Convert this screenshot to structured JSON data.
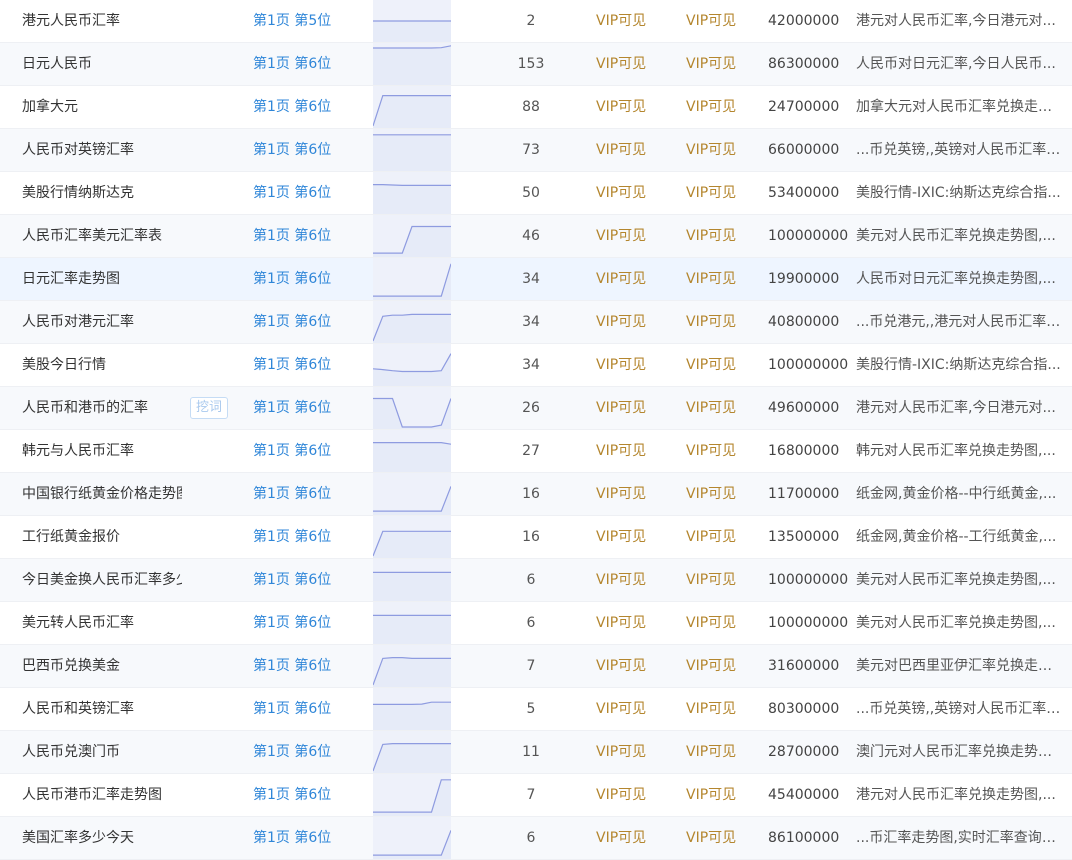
{
  "colors": {
    "link": "#2f86d8",
    "vip": "#b4862e",
    "trend_line": "#8e9be0",
    "trend_bg": "#eef1fa"
  },
  "rows": [
    {
      "keyword": "港元人民币汇率",
      "rank": "第1页 第5位",
      "count": "2",
      "vip1": "VIP可见",
      "vip2": "VIP可见",
      "volume": "42000000",
      "desc": "港元对人民币汇率,今日港元对...",
      "trend": [
        0.5,
        0.5,
        0.5,
        0.5,
        0.5,
        0.5,
        0.5,
        0.5,
        0.5
      ]
    },
    {
      "keyword": "日元人民币",
      "rank": "第1页 第6位",
      "count": "153",
      "vip1": "VIP可见",
      "vip2": "VIP可见",
      "volume": "86300000",
      "desc": "人民币对日元汇率,今日人民币...",
      "trend": [
        0.92,
        0.92,
        0.92,
        0.92,
        0.92,
        0.92,
        0.92,
        0.93,
        0.98
      ]
    },
    {
      "keyword": "加拿大元",
      "rank": "第1页 第6位",
      "count": "88",
      "vip1": "VIP可见",
      "vip2": "VIP可见",
      "volume": "24700000",
      "desc": "加拿大元对人民币汇率兑换走势...",
      "trend": [
        0.0,
        0.8,
        0.8,
        0.8,
        0.8,
        0.8,
        0.8,
        0.8,
        0.8
      ]
    },
    {
      "keyword": "人民币对英镑汇率",
      "rank": "第1页 第6位",
      "count": "73",
      "vip1": "VIP可见",
      "vip2": "VIP可见",
      "volume": "66000000",
      "desc": "...币兑英镑,,英镑对人民币汇率,...",
      "trend": [
        0.9,
        0.9,
        0.9,
        0.9,
        0.9,
        0.9,
        0.9,
        0.9,
        0.9
      ]
    },
    {
      "keyword": "美股行情纳斯达克",
      "rank": "第1页 第6位",
      "count": "50",
      "vip1": "VIP可见",
      "vip2": "VIP可见",
      "volume": "53400000",
      "desc": "美股行情-IXIC:纳斯达克综合指...",
      "trend": [
        0.72,
        0.72,
        0.71,
        0.7,
        0.7,
        0.7,
        0.7,
        0.7,
        0.7
      ]
    },
    {
      "keyword": "人民币汇率美元汇率表",
      "rank": "第1页 第6位",
      "count": "46",
      "vip1": "VIP可见",
      "vip2": "VIP可见",
      "volume": "100000000",
      "desc": "美元对人民币汇率兑换走势图,...",
      "trend": [
        0.05,
        0.05,
        0.05,
        0.05,
        0.75,
        0.75,
        0.75,
        0.75,
        0.75
      ]
    },
    {
      "keyword": "日元汇率走势图",
      "rank": "第1页 第6位",
      "count": "34",
      "vip1": "VIP可见",
      "vip2": "VIP可见",
      "volume": "19900000",
      "desc": "人民币对日元汇率兑换走势图,...",
      "trend": [
        0.05,
        0.05,
        0.05,
        0.05,
        0.05,
        0.05,
        0.05,
        0.05,
        0.9
      ]
    },
    {
      "keyword": "人民币对港元汇率",
      "rank": "第1页 第6位",
      "count": "34",
      "vip1": "VIP可见",
      "vip2": "VIP可见",
      "volume": "40800000",
      "desc": "...币兑港元,,港元对人民币汇率,...",
      "trend": [
        0.0,
        0.65,
        0.68,
        0.68,
        0.7,
        0.7,
        0.7,
        0.7,
        0.7
      ]
    },
    {
      "keyword": "美股今日行情",
      "rank": "第1页 第6位",
      "count": "34",
      "vip1": "VIP可见",
      "vip2": "VIP可见",
      "volume": "100000000",
      "desc": "美股行情-IXIC:纳斯达克综合指...",
      "trend": [
        0.4,
        0.38,
        0.35,
        0.33,
        0.33,
        0.33,
        0.33,
        0.35,
        0.8
      ]
    },
    {
      "keyword": "人民币和港币的汇率",
      "mine": "挖词",
      "rank": "第1页 第6位",
      "count": "26",
      "vip1": "VIP可见",
      "vip2": "VIP可见",
      "volume": "49600000",
      "desc": "港元对人民币汇率,今日港元对...",
      "trend": [
        0.75,
        0.75,
        0.75,
        0.0,
        0.0,
        0.0,
        0.0,
        0.05,
        0.75
      ]
    },
    {
      "keyword": "韩元与人民币汇率",
      "rank": "第1页 第6位",
      "count": "27",
      "vip1": "VIP可见",
      "vip2": "VIP可见",
      "volume": "16800000",
      "desc": "韩元对人民币汇率兑换走势图,...",
      "trend": [
        0.72,
        0.72,
        0.72,
        0.72,
        0.72,
        0.72,
        0.72,
        0.72,
        0.68
      ]
    },
    {
      "keyword": "中国银行纸黄金价格走势图",
      "rank": "第1页 第6位",
      "count": "16",
      "vip1": "VIP可见",
      "vip2": "VIP可见",
      "volume": "11700000",
      "desc": "纸金网,黄金价格--中行纸黄金,...",
      "trend": [
        0.05,
        0.05,
        0.05,
        0.05,
        0.05,
        0.05,
        0.05,
        0.05,
        0.7
      ]
    },
    {
      "keyword": "工行纸黄金报价",
      "rank": "第1页 第6位",
      "count": "16",
      "vip1": "VIP可见",
      "vip2": "VIP可见",
      "volume": "13500000",
      "desc": "纸金网,黄金价格--工行纸黄金,...",
      "trend": [
        0.0,
        0.65,
        0.65,
        0.65,
        0.65,
        0.65,
        0.65,
        0.65,
        0.65
      ]
    },
    {
      "keyword": "今日美金换人民币汇率多少",
      "rank": "第1页 第6位",
      "count": "6",
      "vip1": "VIP可见",
      "vip2": "VIP可见",
      "volume": "100000000",
      "desc": "美元对人民币汇率兑换走势图,...",
      "trend": [
        0.7,
        0.7,
        0.7,
        0.7,
        0.7,
        0.7,
        0.7,
        0.7,
        0.7
      ]
    },
    {
      "keyword": "美元转人民币汇率",
      "rank": "第1页 第6位",
      "count": "6",
      "vip1": "VIP可见",
      "vip2": "VIP可见",
      "volume": "100000000",
      "desc": "美元对人民币汇率兑换走势图,...",
      "trend": [
        0.7,
        0.7,
        0.7,
        0.7,
        0.7,
        0.7,
        0.7,
        0.7,
        0.7
      ]
    },
    {
      "keyword": "巴西币兑换美金",
      "rank": "第1页 第6位",
      "count": "7",
      "vip1": "VIP可见",
      "vip2": "VIP可见",
      "volume": "31600000",
      "desc": "美元对巴西里亚伊汇率兑换走势...",
      "trend": [
        0.0,
        0.7,
        0.72,
        0.72,
        0.7,
        0.7,
        0.7,
        0.7,
        0.7
      ]
    },
    {
      "keyword": "人民币和英镑汇率",
      "rank": "第1页 第6位",
      "count": "5",
      "vip1": "VIP可见",
      "vip2": "VIP可见",
      "volume": "80300000",
      "desc": "...币兑英镑,,英镑对人民币汇率,...",
      "trend": [
        0.62,
        0.62,
        0.62,
        0.62,
        0.62,
        0.63,
        0.68,
        0.68,
        0.68
      ]
    },
    {
      "keyword": "人民币兑澳门币",
      "rank": "第1页 第6位",
      "count": "11",
      "vip1": "VIP可见",
      "vip2": "VIP可见",
      "volume": "28700000",
      "desc": "澳门元对人民币汇率兑换走势图...",
      "trend": [
        0.0,
        0.7,
        0.72,
        0.72,
        0.72,
        0.72,
        0.72,
        0.72,
        0.72
      ]
    },
    {
      "keyword": "人民币港币汇率走势图",
      "rank": "第1页 第6位",
      "count": "7",
      "vip1": "VIP可见",
      "vip2": "VIP可见",
      "volume": "45400000",
      "desc": "港元对人民币汇率兑换走势图,...",
      "trend": [
        0.05,
        0.05,
        0.05,
        0.05,
        0.05,
        0.05,
        0.05,
        0.9,
        0.9
      ]
    },
    {
      "keyword": "美国汇率多少今天",
      "rank": "第1页 第6位",
      "count": "6",
      "vip1": "VIP可见",
      "vip2": "VIP可见",
      "volume": "86100000",
      "desc": "...币汇率走势图,实时汇率查询今...",
      "trend": [
        0.05,
        0.05,
        0.05,
        0.05,
        0.05,
        0.05,
        0.05,
        0.05,
        0.7
      ]
    }
  ]
}
